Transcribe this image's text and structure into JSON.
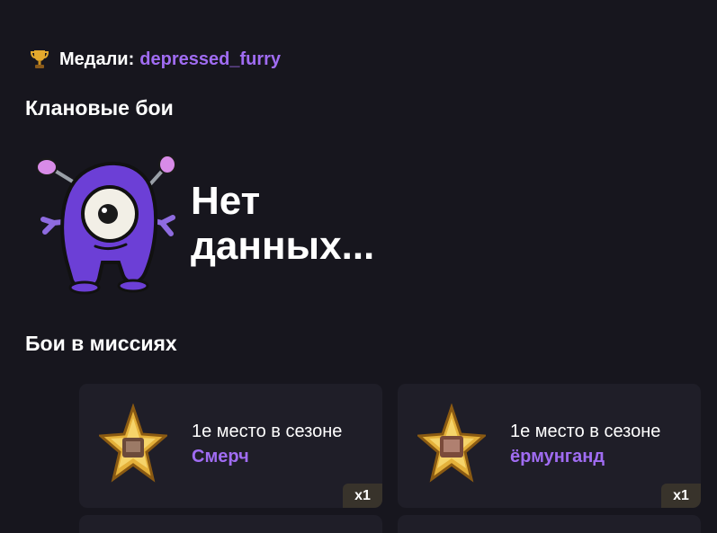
{
  "header": {
    "label": "Медали:",
    "username": "depressed_furry",
    "icon": "trophy-icon"
  },
  "clan_battles": {
    "title": "Клановые бои",
    "empty_text_line1": "Нет",
    "empty_text_line2": "данных...",
    "illustration": "purple-monster"
  },
  "mission_battles": {
    "title": "Бои в миссиях",
    "cards": [
      {
        "place": "1е место в сезоне",
        "mission": "Смерч",
        "count": "x1",
        "icon": "gold-star-medal-icon"
      },
      {
        "place": "1е место в сезоне",
        "mission": "ёрмунганд",
        "count": "x1",
        "icon": "gold-star-medal-icon"
      }
    ]
  },
  "colors": {
    "background": "#17161e",
    "card": "#1f1e28",
    "accent": "#a06cf2",
    "badge": "#38332b",
    "gold": "#e4b13a"
  }
}
